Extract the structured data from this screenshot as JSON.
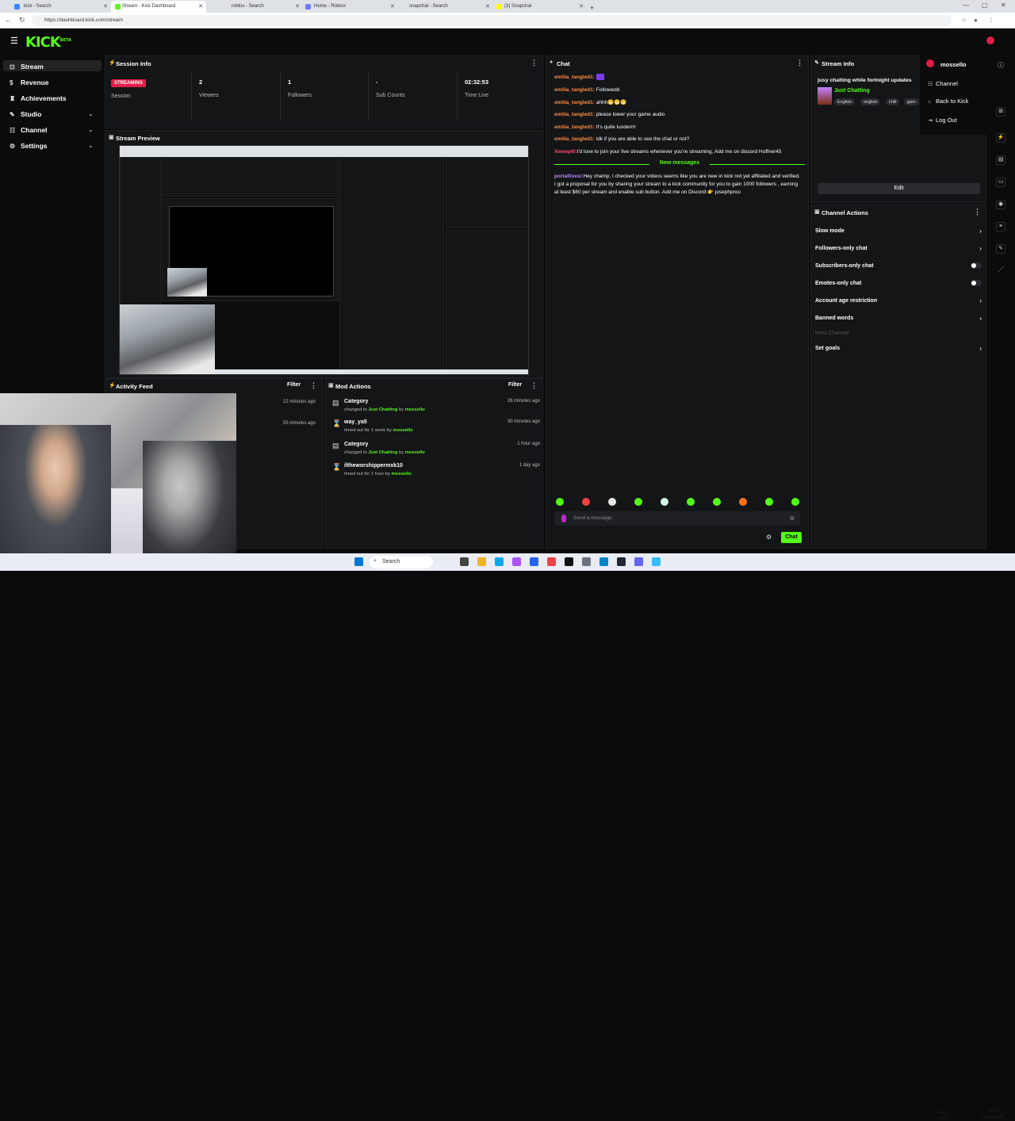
{
  "browser": {
    "tabs": [
      {
        "label": "kick - Search",
        "active": false
      },
      {
        "label": "Stream - Kick Dashboard",
        "active": true
      },
      {
        "label": "roblox - Search",
        "active": false
      },
      {
        "label": "Home - Roblox",
        "active": false
      },
      {
        "label": "snapchat - Search",
        "active": false
      },
      {
        "label": "(3) Snapchat",
        "active": false
      }
    ],
    "url": "https://dashboard.kick.com/stream"
  },
  "brand": {
    "logo": "KICK",
    "beta": "BETA",
    "accent": "#53fc18"
  },
  "sidebar": {
    "items": [
      {
        "label": "Stream",
        "icon": "stream-icon",
        "active": true
      },
      {
        "label": "Revenue",
        "icon": "dollar-icon"
      },
      {
        "label": "Achievements",
        "icon": "trophy-icon"
      },
      {
        "label": "Studio",
        "icon": "studio-icon",
        "expandable": true
      },
      {
        "label": "Channel",
        "icon": "channel-icon",
        "expandable": true
      },
      {
        "label": "Settings",
        "icon": "gear-icon",
        "expandable": true
      }
    ]
  },
  "session": {
    "title": "Session Info",
    "status": "STREAMING",
    "status_label": "Session",
    "viewers": "2",
    "viewers_label": "Viewers",
    "followers": "1",
    "followers_label": "Followers",
    "subs": "-",
    "subs_label": "Sub Counts",
    "time": "02:32:53",
    "time_label": "Time Live"
  },
  "preview": {
    "title": "Stream Preview"
  },
  "chat": {
    "title": "Chat",
    "messages": [
      {
        "user": "emilia_tangled1:",
        "text": ""
      },
      {
        "user": "emilia_tangled1:",
        "text": "Followedd"
      },
      {
        "user": "emilia_tangled1:",
        "text": "ahhh😁😁😁"
      },
      {
        "user": "emilia_tangled1:",
        "text": "please lower your game audio"
      },
      {
        "user": "emilia_tangled1:",
        "text": "It's quite luoderrrr"
      },
      {
        "user": "emilia_tangled1:",
        "text": "idk if you are able to see the chat or not?"
      },
      {
        "user": "Xewopi0:",
        "text": "I'd love to join your live streams whenever you're streaming, Add me on discord Hoffner45"
      }
    ],
    "new_messages": "New messages",
    "new_message": {
      "user": "portallivesi:",
      "text": "Hey champ, I checked your videos seems like you are new in kick not yet affiliated and verified. I got a proposal for you by sharing your stream to a kick community for you to gain 1000 followers , earning at least $60 per stream and enable sub button. Add me on Discord:👉 josephproo"
    },
    "input_placeholder": "Send a message",
    "send_label": "Chat"
  },
  "stream_info": {
    "title": "Stream Info",
    "stream_title": "jusy chatting while fortnight updates",
    "category": "Just Chatting",
    "tags": [
      "English",
      "english",
      "chill",
      "gam"
    ],
    "edit_label": "Edit"
  },
  "channel_actions": {
    "title": "Channel Actions",
    "items": [
      {
        "label": "Slow mode",
        "control": "arrow"
      },
      {
        "label": "Followers-only chat",
        "control": "arrow"
      },
      {
        "label": "Subscribers-only chat",
        "control": "toggle"
      },
      {
        "label": "Emotes-only chat",
        "control": "toggle"
      },
      {
        "label": "Account age restriction",
        "control": "arrow"
      },
      {
        "label": "Banned words",
        "control": "arrow"
      },
      {
        "label": "Host Channel",
        "control": "none",
        "disabled": true
      },
      {
        "label": "Set goals",
        "control": "arrow"
      }
    ]
  },
  "user_menu": {
    "username": "mossello",
    "items": [
      "Channel",
      "Back to Kick",
      "Log Out"
    ]
  },
  "activity": {
    "title": "Activity Feed",
    "filter": "Filter",
    "times": [
      "22 minutes ago",
      "55 minutes ago"
    ]
  },
  "mod_actions": {
    "title": "Mod Actions",
    "filter": "Filter",
    "rows": [
      {
        "title": "Category",
        "pre": "changed to ",
        "value": "Just Chatting",
        "mid": " by ",
        "by": "mossello",
        "time": "26 minutes ago",
        "icon": "category-icon"
      },
      {
        "title": "way_ya5",
        "pre": "timed out for 1 week by ",
        "value": "",
        "mid": "",
        "by": "mossello",
        "time": "30 minutes ago",
        "icon": "hourglass-icon"
      },
      {
        "title": "Category",
        "pre": "changed to ",
        "value": "Just Chatting",
        "mid": " by ",
        "by": "mossello",
        "time": "1 hour ago",
        "icon": "category-icon"
      },
      {
        "title": "iltheworshippermxk10",
        "pre": "timed out for 1 hour by ",
        "value": "",
        "mid": "",
        "by": "mossello",
        "time": "1 day ago",
        "icon": "hourglass-icon"
      }
    ]
  },
  "taskbar": {
    "search": "Search",
    "lang": "ENG",
    "region": "UK",
    "time": "13:07",
    "date": "07/08/2025"
  }
}
